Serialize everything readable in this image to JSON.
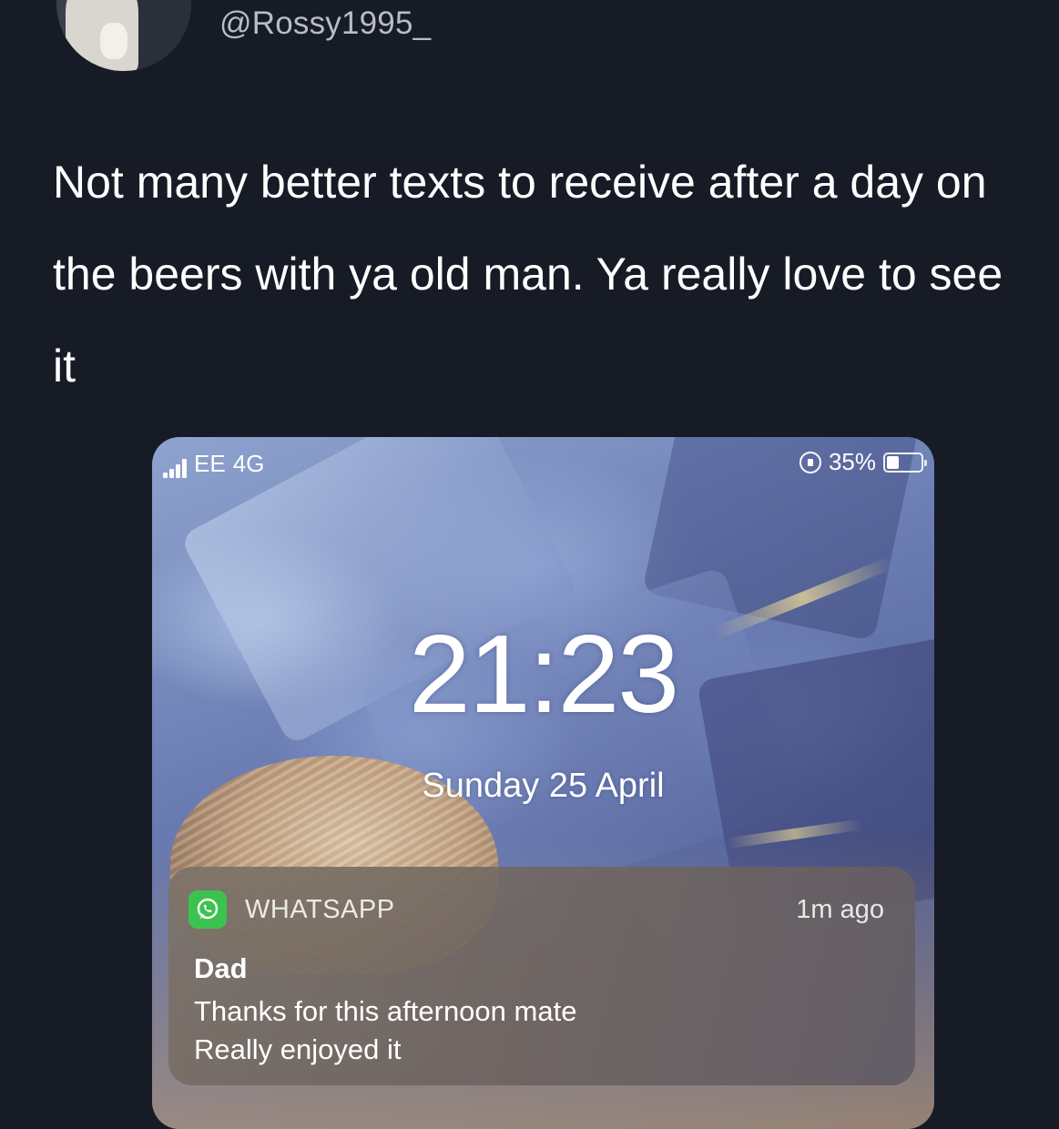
{
  "tweet": {
    "handle": "@Rossy1995_",
    "text": "Not many better texts to receive after a day on the beers with ya old man. Ya really love to see it"
  },
  "lockscreen": {
    "status_bar": {
      "carrier": "EE",
      "network": "4G",
      "battery": "35%",
      "battery_level": 0.35
    },
    "time": "21:23",
    "date": "Sunday 25 April",
    "notification": {
      "app_icon": "whatsapp-icon",
      "app_name": "WHATSAPP",
      "time": "1m ago",
      "sender": "Dad",
      "message_line_1": "Thanks for this afternoon mate",
      "message_line_2": "Really enjoyed it"
    }
  },
  "colors": {
    "background": "#161b26",
    "whatsapp_green": "#3cc34f",
    "handle_gray": "#b8bcc4"
  }
}
